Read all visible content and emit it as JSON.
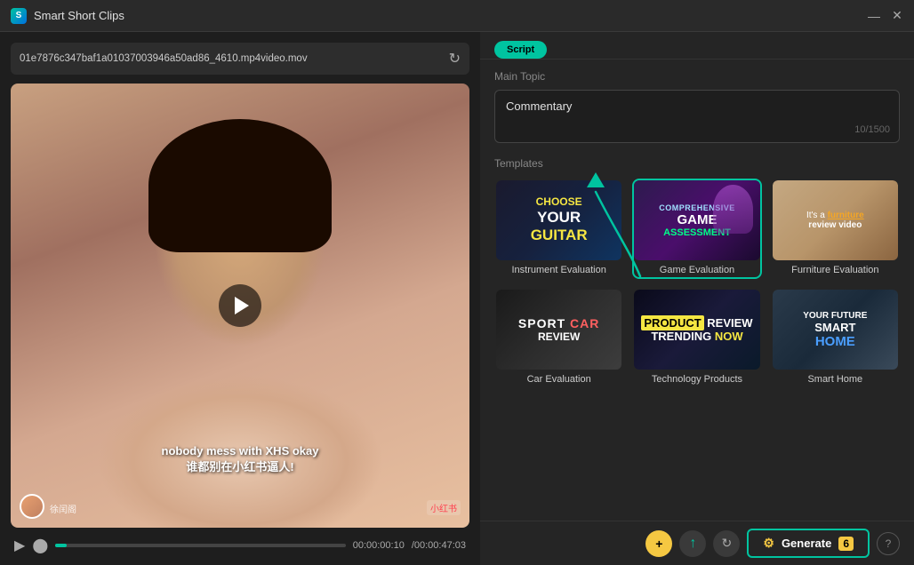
{
  "titlebar": {
    "title": "Smart Short Clips",
    "minimize": "—",
    "close": "✕"
  },
  "left": {
    "filename": "01e7876c347baf1a01037003946a50ad86_4610.mp4video.mov",
    "subtitle_line1": "nobody mess with XHS okay",
    "subtitle_line2": "谁都别在小红书逼人!",
    "username": "徐闰阁",
    "platform": "小红书",
    "time_current": "00:00:00:10",
    "time_total": "/00:00:47:03"
  },
  "right": {
    "tab_label": "Script",
    "main_topic_label": "Main Topic",
    "main_topic_text": "Commentary",
    "char_count": "10/1500",
    "templates_label": "Templates",
    "arrow_hint": "↑",
    "templates": [
      {
        "id": "instrument-evaluation",
        "label": "Instrument Evaluation",
        "bg_class": "tmpl-guitar",
        "selected": false,
        "overlay": "guitar"
      },
      {
        "id": "game-evaluation",
        "label": "Game Evaluation",
        "bg_class": "tmpl-game",
        "selected": true,
        "overlay": "game"
      },
      {
        "id": "furniture-evaluation",
        "label": "Furniture Evaluation",
        "bg_class": "tmpl-furniture",
        "selected": false,
        "overlay": "furniture"
      },
      {
        "id": "car-evaluation",
        "label": "Car Evaluation",
        "bg_class": "tmpl-car",
        "selected": false,
        "overlay": "car"
      },
      {
        "id": "technology-products",
        "label": "Technology Products",
        "bg_class": "tmpl-tech",
        "selected": false,
        "overlay": "tech"
      },
      {
        "id": "smart-home",
        "label": "Smart Home",
        "bg_class": "tmpl-home",
        "selected": false,
        "overlay": "home"
      }
    ]
  },
  "bottombar": {
    "generate_label": "Generate",
    "generate_count": "6",
    "plus_icon": "+",
    "arrow_icon": "↑",
    "refresh_icon": "↻",
    "help_icon": "?"
  }
}
